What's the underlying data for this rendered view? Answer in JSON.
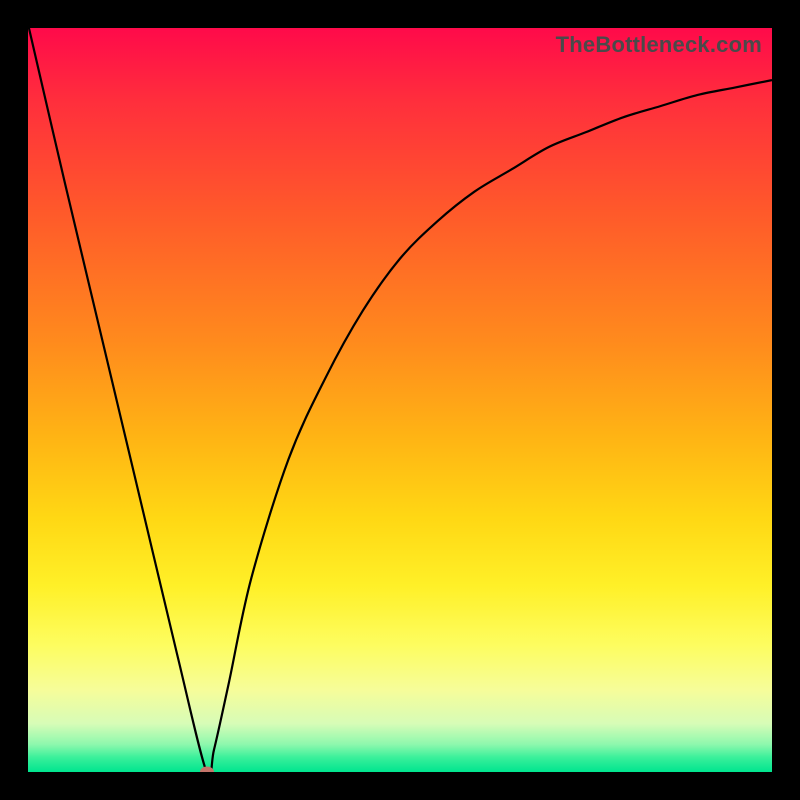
{
  "watermark": "TheBottleneck.com",
  "colors": {
    "frame": "#000000",
    "curve": "#000000",
    "marker": "#c5746a",
    "gradient_top": "#ff0a4a",
    "gradient_bottom": "#00e58f"
  },
  "chart_data": {
    "type": "line",
    "title": "",
    "xlabel": "",
    "ylabel": "",
    "xlim": [
      0,
      100
    ],
    "ylim": [
      0,
      100
    ],
    "x": [
      0,
      5,
      10,
      15,
      20,
      24,
      25,
      27,
      30,
      35,
      40,
      45,
      50,
      55,
      60,
      65,
      70,
      75,
      80,
      85,
      90,
      95,
      100
    ],
    "values": [
      100,
      79,
      58,
      37,
      16,
      0,
      3,
      12,
      26,
      42,
      53,
      62,
      69,
      74,
      78,
      81,
      84,
      86,
      88,
      89.5,
      91,
      92,
      93
    ],
    "marker_point": {
      "x": 24,
      "y": 0
    },
    "inverted_y_down_is_good": true
  }
}
